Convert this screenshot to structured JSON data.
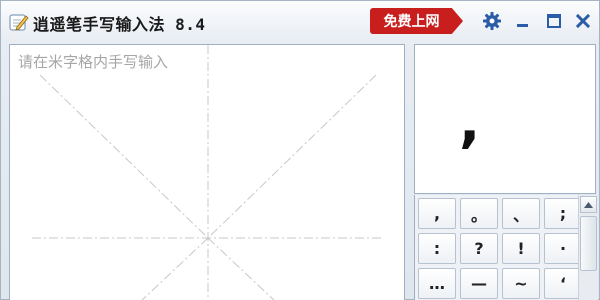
{
  "window": {
    "title": "逍遥笔手写输入法 8.4",
    "online_button": "免费上网",
    "icons": [
      "pen-icon",
      "gear-icon",
      "minimize-icon",
      "maximize-icon",
      "close-icon"
    ]
  },
  "canvas": {
    "placeholder": "请在米字格内手写输入"
  },
  "preview": {
    "character": ","
  },
  "candidates": [
    ",",
    "。",
    "、",
    ";",
    ":",
    "?",
    "!",
    "·",
    "…",
    "—",
    "~",
    "‘"
  ],
  "colors": {
    "accent": "#c81e1e",
    "title_icons": "#2b5ca8"
  }
}
